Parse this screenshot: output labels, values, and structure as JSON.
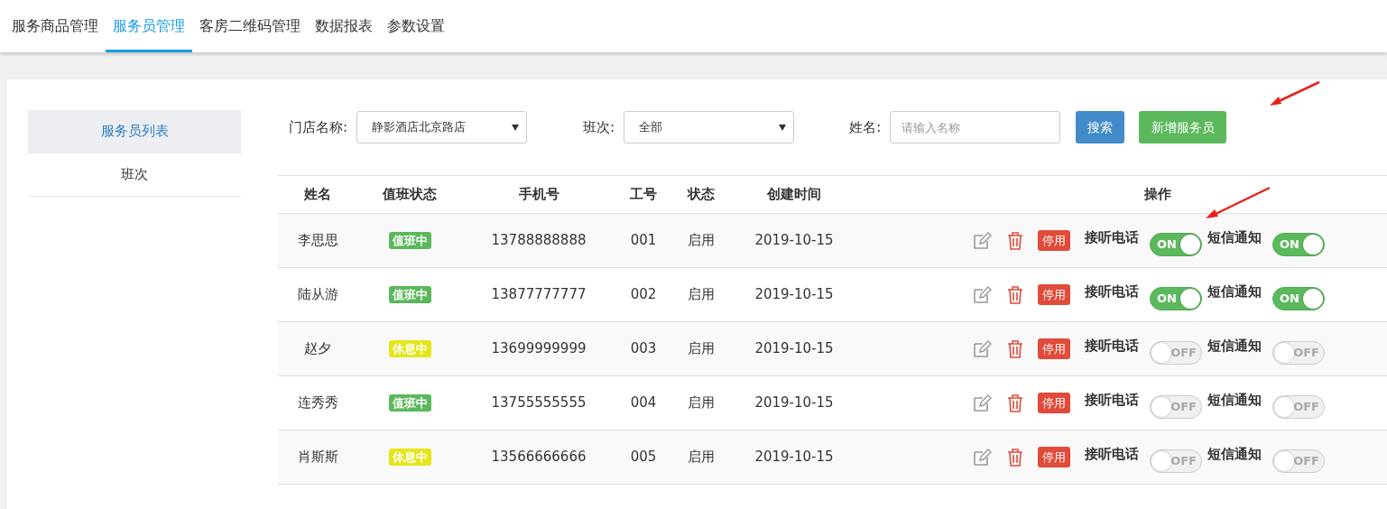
{
  "nav_tabs": [
    {
      "label": "服务商品管理",
      "selected": false
    },
    {
      "label": "服务员管理",
      "selected": true
    },
    {
      "label": "客房二维码管理",
      "selected": false
    },
    {
      "label": "数据报表",
      "selected": false
    },
    {
      "label": "参数设置",
      "selected": false
    }
  ],
  "sidebar": {
    "items": [
      {
        "label": "服务员列表",
        "selected": true
      },
      {
        "label": "班次",
        "selected": false
      }
    ]
  },
  "filters": {
    "store": {
      "label": "门店名称:",
      "value": "静影酒店北京路店"
    },
    "shift": {
      "label": "班次:",
      "value": "全部"
    },
    "name": {
      "label": "姓名:",
      "placeholder": "请输入名称"
    },
    "search_button": "搜索",
    "add_button": "新增服务员"
  },
  "table": {
    "columns": [
      "姓名",
      "值班状态",
      "手机号",
      "工号",
      "状态",
      "创建时间",
      "操作"
    ],
    "rows": [
      {
        "name": "李思思",
        "duty": {
          "text": "值班中",
          "color": "#5cb85c"
        },
        "phone": "13788888888",
        "id": "001",
        "status": "启用",
        "created": "2019-10-15",
        "disable_button": "停用",
        "call_label": "接听电话",
        "call_on": true,
        "call_switch_text": "ON",
        "sms_label": "短信通知",
        "sms_on": true,
        "sms_switch_text": "ON"
      },
      {
        "name": "陆从游",
        "duty": {
          "text": "值班中",
          "color": "#5cb85c"
        },
        "phone": "13877777777",
        "id": "002",
        "status": "启用",
        "created": "2019-10-15",
        "disable_button": "停用",
        "call_label": "接听电话",
        "call_on": true,
        "call_switch_text": "ON",
        "sms_label": "短信通知",
        "sms_on": true,
        "sms_switch_text": "ON"
      },
      {
        "name": "赵夕",
        "duty": {
          "text": "休息中",
          "color": "#e5e61c"
        },
        "phone": "13699999999",
        "id": "003",
        "status": "启用",
        "created": "2019-10-15",
        "disable_button": "停用",
        "call_label": "接听电话",
        "call_on": false,
        "call_switch_text": "OFF",
        "sms_label": "短信通知",
        "sms_on": false,
        "sms_switch_text": "OFF"
      },
      {
        "name": "连秀秀",
        "duty": {
          "text": "值班中",
          "color": "#5cb85c"
        },
        "phone": "13755555555",
        "id": "004",
        "status": "启用",
        "created": "2019-10-15",
        "disable_button": "停用",
        "call_label": "接听电话",
        "call_on": false,
        "call_switch_text": "OFF",
        "sms_label": "短信通知",
        "sms_on": false,
        "sms_switch_text": "OFF"
      },
      {
        "name": "肖斯斯",
        "duty": {
          "text": "休息中",
          "color": "#e5e61c"
        },
        "phone": "13566666666",
        "id": "005",
        "status": "启用",
        "created": "2019-10-15",
        "disable_button": "停用",
        "call_label": "接听电话",
        "call_on": false,
        "call_switch_text": "OFF",
        "sms_label": "短信通知",
        "sms_on": false,
        "sms_switch_text": "OFF"
      }
    ]
  }
}
